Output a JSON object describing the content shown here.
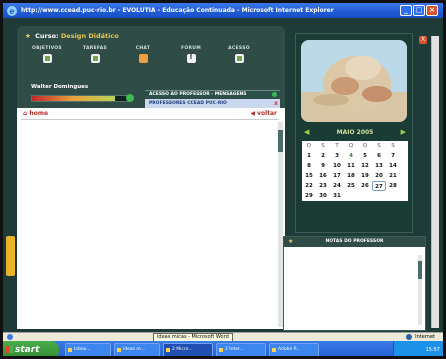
{
  "window": {
    "title": "http://www.ccead.puc-rio.br - EVOLUTIA - Educação Continuada - Microsoft Internet Explorer",
    "close_label": "X"
  },
  "course": {
    "prefix": "Curso:",
    "name": "Design Didático"
  },
  "nav": [
    {
      "label": "OBJETIVOS",
      "icon": "objectives-icon"
    },
    {
      "label": "TAREFAS",
      "icon": "tasks-icon"
    },
    {
      "label": "CHAT",
      "icon": "chat-icon"
    },
    {
      "label": "FÓRUM",
      "icon": "forum-icon"
    },
    {
      "label": "ACESSO",
      "icon": "access-icon"
    }
  ],
  "user": {
    "name": "Walter Domingues",
    "progress": 0.85
  },
  "messages": {
    "tab_label": "ACESSO AO PROFESSOR - MENSAGENS",
    "recipient": "PROFESSORES CCEAD PUC-RIO",
    "close": "x"
  },
  "content": {
    "home_label": "home",
    "back_label": "voltar"
  },
  "side_tab": {
    "icon": "drawer-tab-icon"
  },
  "calendar": {
    "month": "MAIO 2005",
    "prev_arrow": "◀",
    "next_arrow": "▶",
    "weekdays": [
      "D",
      "S",
      "T",
      "Q",
      "Q",
      "S",
      "S"
    ],
    "weeks": [
      [
        "1",
        "2",
        "3",
        "4",
        "5",
        "6",
        "7"
      ],
      [
        "8",
        "9",
        "10",
        "11",
        "12",
        "13",
        "14"
      ],
      [
        "15",
        "16",
        "17",
        "18",
        "19",
        "20",
        "21"
      ],
      [
        "22",
        "23",
        "24",
        "25",
        "26",
        "27",
        "28"
      ],
      [
        "29",
        "30",
        "31",
        "",
        "",
        "",
        ""
      ]
    ],
    "highlight_day": "4",
    "selected_day": "27"
  },
  "notes": {
    "title": "NOTAS DO PROFESSOR"
  },
  "statusbar": {
    "tooltip": "ideas micas - Microsoft Word",
    "zone": "Internet"
  },
  "taskbar": {
    "start": "start",
    "tasks": [
      "Inbox...",
      "ideas m...",
      "2 Micro...",
      "2 Inter...",
      "Adobe P..."
    ],
    "clock": "15:57"
  },
  "colors": {
    "app_background": "#1f3b37",
    "accent_gold": "#e6c84a",
    "link_red": "#b5322e",
    "calendar_green": "#9ad34a"
  }
}
